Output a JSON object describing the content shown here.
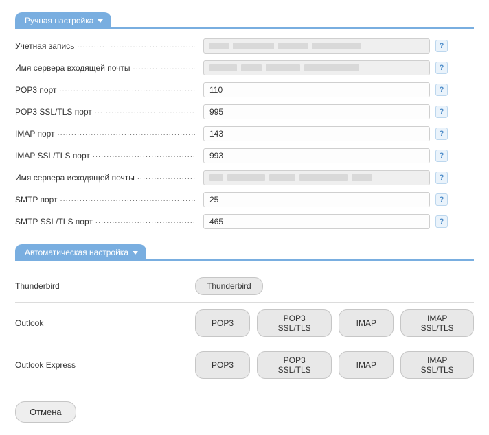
{
  "manual": {
    "tab_label": "Ручная настройка",
    "rows": {
      "account": {
        "label": "Учетная запись",
        "value": ""
      },
      "incoming": {
        "label": "Имя сервера входящей почты",
        "value": ""
      },
      "pop3_port": {
        "label": "POP3 порт",
        "value": "110"
      },
      "pop3_ssl_port": {
        "label": "POP3 SSL/TLS порт",
        "value": "995"
      },
      "imap_port": {
        "label": "IMAP порт",
        "value": "143"
      },
      "imap_ssl_port": {
        "label": "IMAP SSL/TLS порт",
        "value": "993"
      },
      "outgoing": {
        "label": "Имя сервера исходящей почты",
        "value": ""
      },
      "smtp_port": {
        "label": "SMTP порт",
        "value": "25"
      },
      "smtp_ssl_port": {
        "label": "SMTP SSL/TLS порт",
        "value": "465"
      }
    },
    "help_symbol": "?"
  },
  "auto": {
    "tab_label": "Автоматическая настройка",
    "rows": {
      "thunderbird": {
        "label": "Thunderbird",
        "buttons": [
          "Thunderbird"
        ]
      },
      "outlook": {
        "label": "Outlook",
        "buttons": [
          "POP3",
          "POP3 SSL/TLS",
          "IMAP",
          "IMAP SSL/TLS"
        ]
      },
      "outlook_express": {
        "label": "Outlook Express",
        "buttons": [
          "POP3",
          "POP3 SSL/TLS",
          "IMAP",
          "IMAP SSL/TLS"
        ]
      }
    }
  },
  "cancel_label": "Отмена"
}
